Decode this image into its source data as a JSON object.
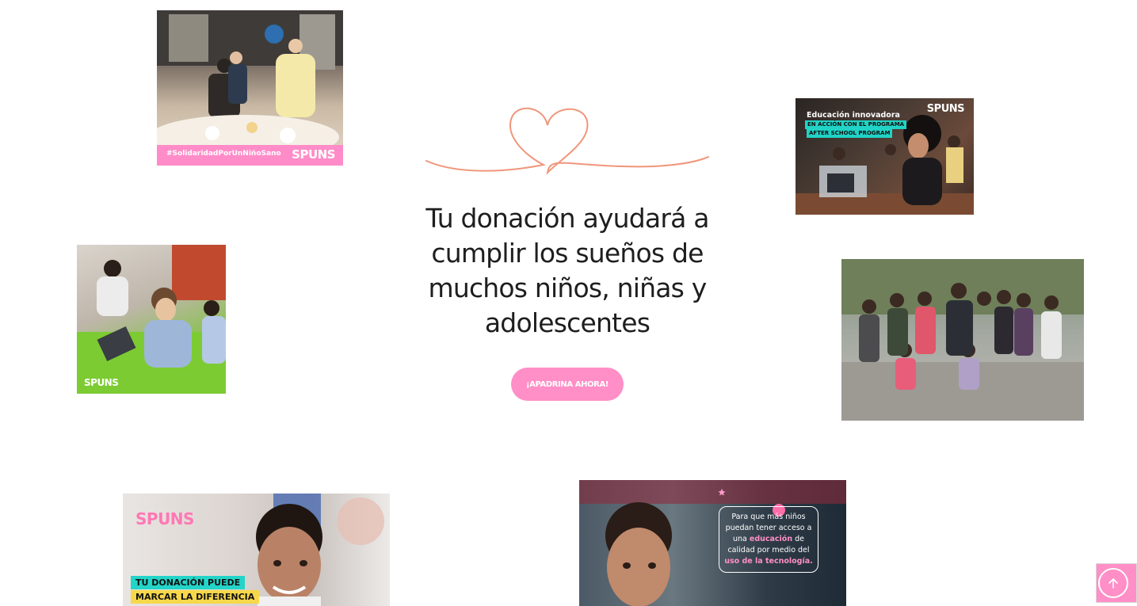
{
  "hero": {
    "title": "Tu donación ayudará a cumplir los sueños de muchos niños, niñas y adolescentes",
    "cta_label": "¡APADRINA AHORA!"
  },
  "colors": {
    "brand_pink": "#ff8fc6",
    "heart_line": "#f0967a",
    "title_text": "#1e1e1e"
  },
  "photos": {
    "event": {
      "hashtag": "#SolidaridadPorUnNiñoSano",
      "brand": "SPUNS"
    },
    "classroom_laptop": {
      "brand": "SPUNS",
      "headline": "Educación innovadora",
      "tag_line1": "EN ACCIÓN CON EL PROGRAMA",
      "tag_line2": "AFTER SCHOOL PROGRAM"
    },
    "tablets": {
      "brand": "SPUNS"
    },
    "group": {},
    "boy_smile": {
      "brand": "SPUNS",
      "badge_line1": "TU DONACIÓN PUEDE",
      "badge_line2": "MARCAR LA DIFERENCIA"
    },
    "boy_classroom": {
      "bubble_pre": "Para que más niños puedan tener acceso a una",
      "bubble_hl1": "educación",
      "bubble_mid": "de calidad por medio del",
      "bubble_hl2": "uso de la tecnología."
    }
  },
  "icons": {
    "decor": "heart-line-icon",
    "scroll": "arrow-up-icon"
  }
}
